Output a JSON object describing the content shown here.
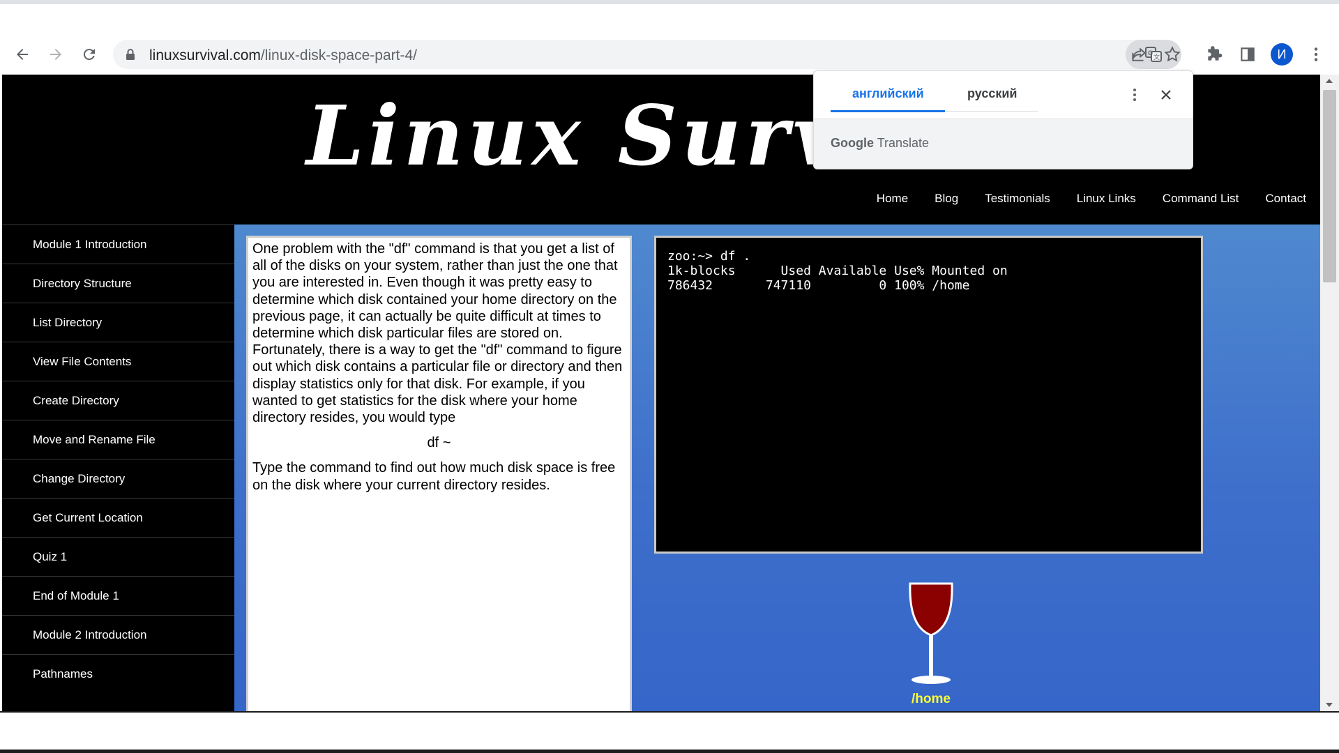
{
  "browser": {
    "url_domain": "linuxsurvival.com",
    "url_path": "/linux-disk-space-part-4/",
    "profile_initial": "И",
    "accent_color": "#0b57d0"
  },
  "translate_popup": {
    "source_lang": "английский",
    "target_lang": "русский",
    "brand_google": "Google",
    "brand_translate": "Translate"
  },
  "site": {
    "logo_text": "Linux Surv",
    "nav": [
      "Home",
      "Blog",
      "Testimonials",
      "Linux Links",
      "Command List",
      "Contact"
    ]
  },
  "sidebar": {
    "items": [
      "Module 1 Introduction",
      "Directory Structure",
      "List Directory",
      "View File Contents",
      "Create Directory",
      "Move and Rename File",
      "Change Directory",
      "Get Current Location",
      "Quiz 1",
      "End of Module 1",
      "Module 2 Introduction",
      "Pathnames"
    ]
  },
  "lesson": {
    "paragraph": "One problem with the \"df\" command is that you get a list of all of the disks on your system, rather than just the one that you are interested in. Even though it was pretty easy to determine which disk contained your home directory on the previous page, it can actually be quite difficult at times to determine which disk particular files are stored on. Fortunately, there is a way to get the \"df\" command to figure out which disk contains a particular file or directory and then display statistics only for that disk. For example, if you wanted to get statistics for the disk where your home directory resides, you would type",
    "example": "df ~",
    "task": "Type the command to find out how much disk space is free on the disk where your current directory resides."
  },
  "terminal": {
    "line1": "zoo:~> df .",
    "line2": "1k-blocks      Used Available Use% Mounted on",
    "line3": "786432       747110         0 100% /home"
  },
  "wine": {
    "label": "/home",
    "wine_color": "#8b0000"
  }
}
